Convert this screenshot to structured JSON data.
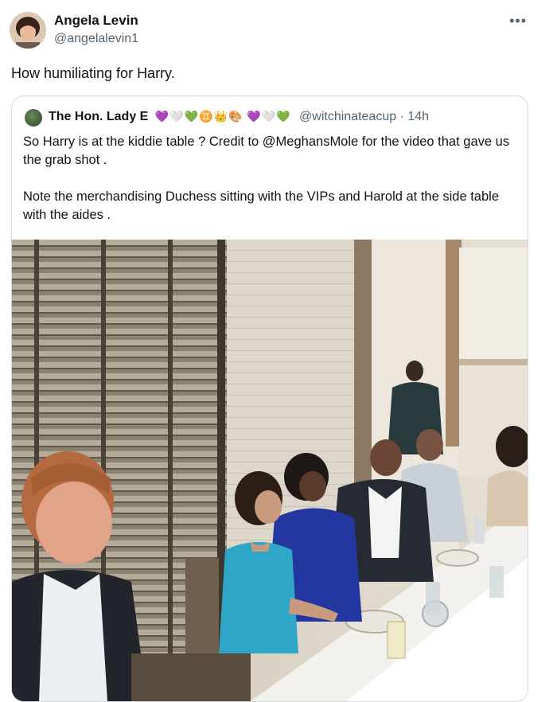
{
  "tweet": {
    "author_name": "Angela Levin",
    "author_handle": "@angelalevin1",
    "more_icon": "more-options-icon",
    "text": "How humiliating for Harry."
  },
  "quoted": {
    "author_name": "The Hon. Lady E",
    "emojis": "💜🤍💚♊👑🎨 💜🤍💚",
    "handle_time": "@witchinateacup · 14h",
    "paragraph_1": "So Harry is at the kiddie table ? Credit to @MeghansMole for the video that gave us the grab shot .",
    "paragraph_2": "Note the merchandising Duchess sitting with the VIPs and Harold at the side table with the aides ."
  },
  "colors": {
    "text": "#0f1419",
    "secondary": "#536471",
    "border": "#cfd9de"
  }
}
